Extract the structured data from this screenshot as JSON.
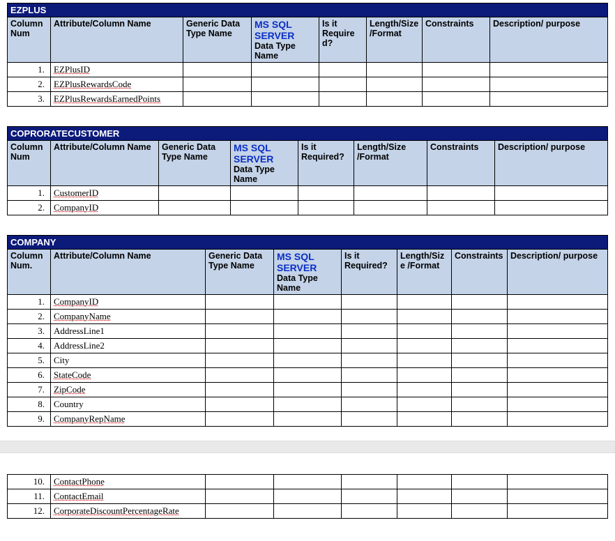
{
  "shared": {
    "col_num_a": "Column Num",
    "col_num_b": "Column Num.",
    "attr": "Attribute/Column Name",
    "generic": "Generic Data Type Name",
    "mssql": "MS SQL SERVER",
    "mssql_sub": "Data Type Name",
    "req_a": "Is it Required?",
    "req_b": "Is it Required?",
    "len": "Length/Size /Format",
    "constraints": "Constraints",
    "desc": "Description/ purpose"
  },
  "tables": {
    "ezplus": {
      "title": "EZPLUS",
      "rows": [
        {
          "num": "1.",
          "name": "EZPlusID",
          "under": true
        },
        {
          "num": "2.",
          "name": "EZPlusRewardsCode",
          "under": true
        },
        {
          "num": "3.",
          "name": "EZPlusRewardsEarnedPoints",
          "under": true
        }
      ]
    },
    "corp": {
      "title": "COPRORATECUSTOMER",
      "rows": [
        {
          "num": "1.",
          "name": "CustomerID",
          "under": true
        },
        {
          "num": "2.",
          "name": "CompanyID",
          "under": true
        }
      ]
    },
    "company": {
      "title": "COMPANY",
      "rows_a": [
        {
          "num": "1.",
          "name": "CompanyID",
          "under": true
        },
        {
          "num": "2.",
          "name": "CompanyName",
          "under": true
        },
        {
          "num": "3.",
          "name": "AddressLine1",
          "under": false
        },
        {
          "num": "4.",
          "name": "AddressLine2",
          "under": false
        },
        {
          "num": "5.",
          "name": "City",
          "under": false
        },
        {
          "num": "6.",
          "name": "StateCode",
          "under": true
        },
        {
          "num": "7.",
          "name": "ZipCode",
          "under": true
        },
        {
          "num": "8.",
          "name": "Country",
          "under": false
        },
        {
          "num": "9.",
          "name": "CompanyRepName",
          "under": true
        }
      ],
      "rows_b": [
        {
          "num": "10.",
          "name": "ContactPhone",
          "under": true
        },
        {
          "num": "11.",
          "name": "ContactEmail",
          "under": true
        },
        {
          "num": "12.",
          "name": "CorporateDiscountPercentageRate",
          "under": true
        }
      ]
    }
  }
}
